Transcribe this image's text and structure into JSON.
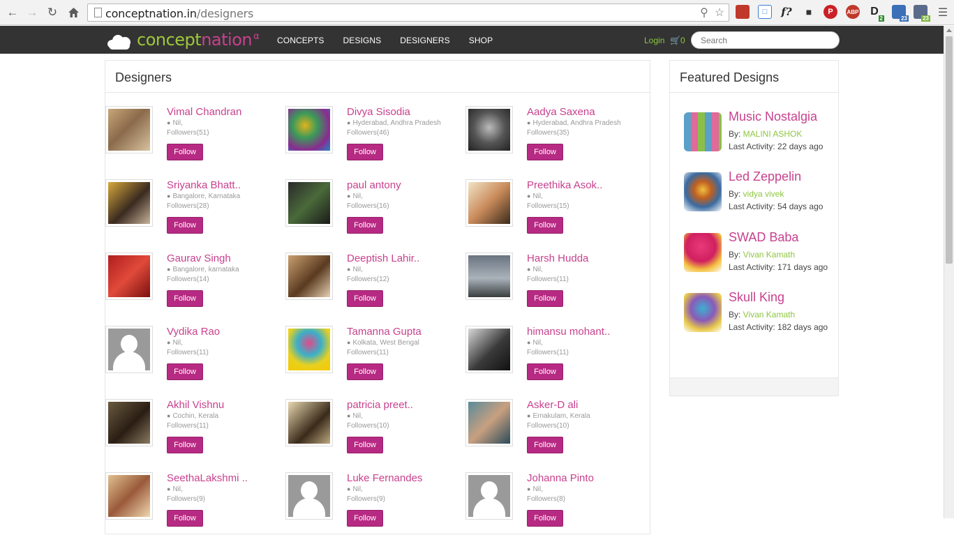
{
  "browser": {
    "url_host": "conceptnation.in",
    "url_path": "/designers",
    "extension_badges": [
      "2",
      "23",
      "23"
    ]
  },
  "site": {
    "logo_part1": "concept",
    "logo_part2": "nation",
    "logo_suffix": "α",
    "menu": [
      "CONCEPTS",
      "DESIGNS",
      "DESIGNERS",
      "SHOP"
    ],
    "login": "Login",
    "cart_count": "0",
    "search_placeholder": "Search"
  },
  "designers_panel": {
    "title": "Designers",
    "follow_label": "Follow",
    "designers": [
      {
        "name": "Vimal Chandran",
        "location": "Nil,",
        "followers": "Followers(51)"
      },
      {
        "name": "Divya Sisodia",
        "location": "Hyderabad, Andhra Pradesh",
        "followers": "Followers(46)"
      },
      {
        "name": "Aadya Saxena",
        "location": "Hyderabad, Andhra Pradesh",
        "followers": "Followers(35)"
      },
      {
        "name": "Sriyanka Bhatt..",
        "location": "Bangalore, Karnataka",
        "followers": "Followers(28)"
      },
      {
        "name": "paul antony",
        "location": "Nil,",
        "followers": "Followers(16)"
      },
      {
        "name": "Preethika Asok..",
        "location": "Nil,",
        "followers": "Followers(15)"
      },
      {
        "name": "Gaurav Singh",
        "location": "Bangalore, karnataka",
        "followers": "Followers(14)"
      },
      {
        "name": "Deeptish Lahir..",
        "location": "Nil,",
        "followers": "Followers(12)"
      },
      {
        "name": "Harsh Hudda",
        "location": "Nil,",
        "followers": "Followers(11)"
      },
      {
        "name": "Vydika Rao",
        "location": "Nil,",
        "followers": "Followers(11)"
      },
      {
        "name": "Tamanna Gupta",
        "location": "Kolkata, West Bengal",
        "followers": "Followers(11)"
      },
      {
        "name": "himansu mohant..",
        "location": "Nil,",
        "followers": "Followers(11)"
      },
      {
        "name": "Akhil Vishnu",
        "location": "Cochin, Kerala",
        "followers": "Followers(11)"
      },
      {
        "name": "patricia preet..",
        "location": "Nil,",
        "followers": "Followers(10)"
      },
      {
        "name": "Asker-D ali",
        "location": "Ernakulam, Kerala",
        "followers": "Followers(10)"
      },
      {
        "name": "SeethaLakshmi ..",
        "location": "Nil,",
        "followers": "Followers(9)"
      },
      {
        "name": "Luke Fernandes",
        "location": "Nil,",
        "followers": "Followers(9)"
      },
      {
        "name": "Johanna Pinto",
        "location": "Nil,",
        "followers": "Followers(8)"
      }
    ]
  },
  "featured": {
    "title": "Featured Designs",
    "by_label": "By:",
    "items": [
      {
        "title": "Music Nostalgia",
        "author": "MALINI ASHOK",
        "activity": "Last Activity: 22 days ago"
      },
      {
        "title": "Led Zeppelin",
        "author": "vidya vivek",
        "activity": "Last Activity: 54 days ago"
      },
      {
        "title": "SWAD Baba",
        "author": "Vivan Kamath",
        "activity": "Last Activity: 171 days ago"
      },
      {
        "title": "Skull King",
        "author": "Vivan Kamath",
        "activity": "Last Activity: 182 days ago"
      }
    ]
  },
  "colors": {
    "brand_pink": "#c8418e",
    "brand_green": "#8dc63f",
    "follow_button": "#b72a83",
    "navbar": "#333333"
  }
}
